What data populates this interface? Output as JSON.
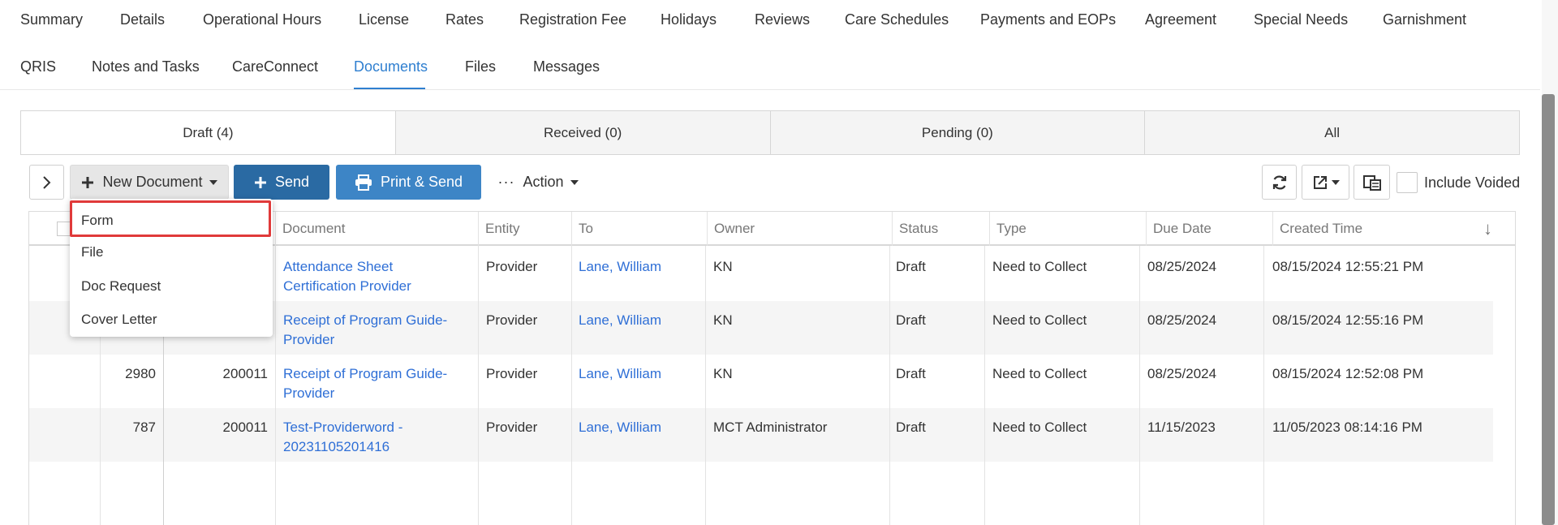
{
  "nav": {
    "row1": [
      "Summary",
      "Details",
      "Operational Hours",
      "License",
      "Rates",
      "Registration Fee",
      "Holidays",
      "Reviews",
      "Care Schedules",
      "Payments and EOPs",
      "Agreement",
      "Special Needs",
      "Garnishment"
    ],
    "row2": [
      "QRIS",
      "Notes and Tasks",
      "CareConnect",
      "Documents",
      "Files",
      "Messages"
    ],
    "active": "Documents"
  },
  "subtabs": [
    "Draft (4)",
    "Received (0)",
    "Pending (0)",
    "All"
  ],
  "toolbar": {
    "new_document": "New Document",
    "send": "Send",
    "print_send": "Print & Send",
    "action": "Action",
    "include_voided": "Include Voided"
  },
  "dropdown": {
    "items": [
      "Form",
      "File",
      "Doc Request",
      "Cover Letter"
    ],
    "highlighted": "Form"
  },
  "columns": [
    "Document",
    "Entity",
    "To",
    "Owner",
    "Status",
    "Type",
    "Due Date",
    "Created Time"
  ],
  "rows": [
    {
      "id": "",
      "code": "",
      "document": [
        "Attendance Sheet",
        "Certification Provider"
      ],
      "entity": "Provider",
      "to": "Lane, William",
      "owner": "KN",
      "status": "Draft",
      "type": "Need to Collect",
      "due": "08/25/2024",
      "created": "08/15/2024 12:55:21 PM"
    },
    {
      "id": "",
      "code": "",
      "document": [
        "Receipt of Program Guide-",
        "Provider"
      ],
      "entity": "Provider",
      "to": "Lane, William",
      "owner": "KN",
      "status": "Draft",
      "type": "Need to Collect",
      "due": "08/25/2024",
      "created": "08/15/2024 12:55:16 PM"
    },
    {
      "id": "2980",
      "code": "200011",
      "document": [
        "Receipt of Program Guide-",
        "Provider"
      ],
      "entity": "Provider",
      "to": "Lane, William",
      "owner": "KN",
      "status": "Draft",
      "type": "Need to Collect",
      "due": "08/25/2024",
      "created": "08/15/2024 12:52:08 PM"
    },
    {
      "id": "787",
      "code": "200011",
      "document": [
        "Test-Providerword -",
        "20231105201416"
      ],
      "entity": "Provider",
      "to": "Lane, William",
      "owner": "MCT Administrator",
      "status": "Draft",
      "type": "Need to Collect",
      "due": "11/15/2023",
      "created": "11/05/2023 08:14:16 PM"
    }
  ],
  "colors": {
    "accent": "#2f7fd0",
    "send": "#2a6aa3",
    "print": "#3d85c6",
    "highlight": "#e03a3a",
    "link": "#2f6fd6"
  }
}
